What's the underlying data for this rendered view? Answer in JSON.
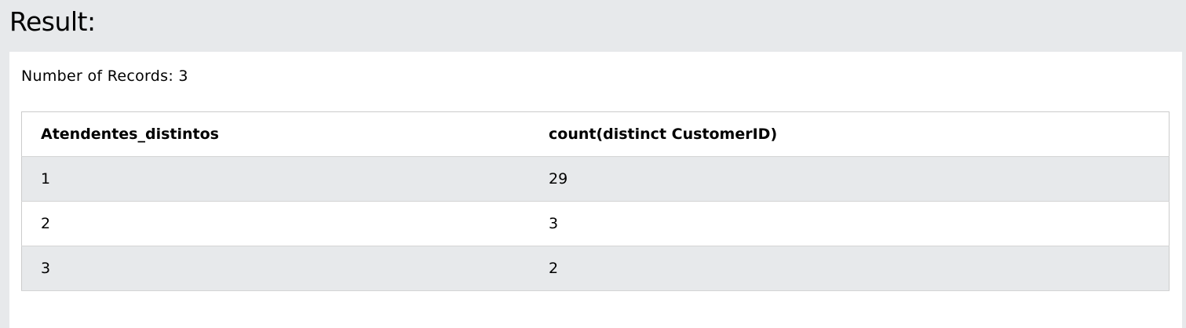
{
  "heading": "Result:",
  "record_count_text": "Number of Records: 3",
  "table": {
    "columns": [
      "Atendentes_distintos",
      "count(distinct CustomerID)"
    ],
    "rows": [
      [
        "1",
        "29"
      ],
      [
        "2",
        "3"
      ],
      [
        "3",
        "2"
      ]
    ]
  }
}
